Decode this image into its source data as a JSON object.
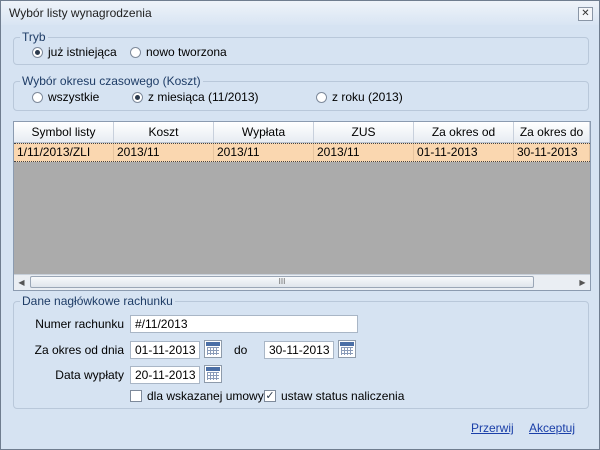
{
  "window": {
    "title": "Wybór listy wynagrodzenia"
  },
  "tryb": {
    "legend": "Tryb",
    "options": [
      {
        "label": "już istniejąca",
        "checked": true
      },
      {
        "label": "nowo tworzona",
        "checked": false
      }
    ]
  },
  "okres": {
    "legend": "Wybór okresu czasowego (Koszt)",
    "options": [
      {
        "label": "wszystkie",
        "checked": false
      },
      {
        "label": "z miesiąca (11/2013)",
        "checked": true
      },
      {
        "label": "z roku (2013)",
        "checked": false
      }
    ]
  },
  "grid": {
    "columns": [
      "Symbol listy",
      "Koszt",
      "Wypłata",
      "ZUS",
      "Za okres od",
      "Za okres do"
    ],
    "rows": [
      [
        "1/11/2013/ZLI",
        "2013/11",
        "2013/11",
        "2013/11",
        "01-11-2013",
        "30-11-2013"
      ]
    ],
    "scroll_thumb_glyph": "III"
  },
  "dane": {
    "legend": "Dane nagłówkowe rachunku",
    "numer_label": "Numer rachunku",
    "numer_value": "#/11/2013",
    "okres_label": "Za okres od dnia",
    "okres_od": "01-11-2013",
    "do_label": "do",
    "okres_do": "30-11-2013",
    "wyplata_label": "Data wypłaty",
    "wyplata_value": "20-11-2013",
    "umowa_label": "dla wskazanej umowy",
    "umowa_checked": false,
    "status_label": "ustaw status naliczenia",
    "status_checked": true
  },
  "footer": {
    "cancel_label": "Przerwij",
    "accept_label": "Akceptuj"
  }
}
